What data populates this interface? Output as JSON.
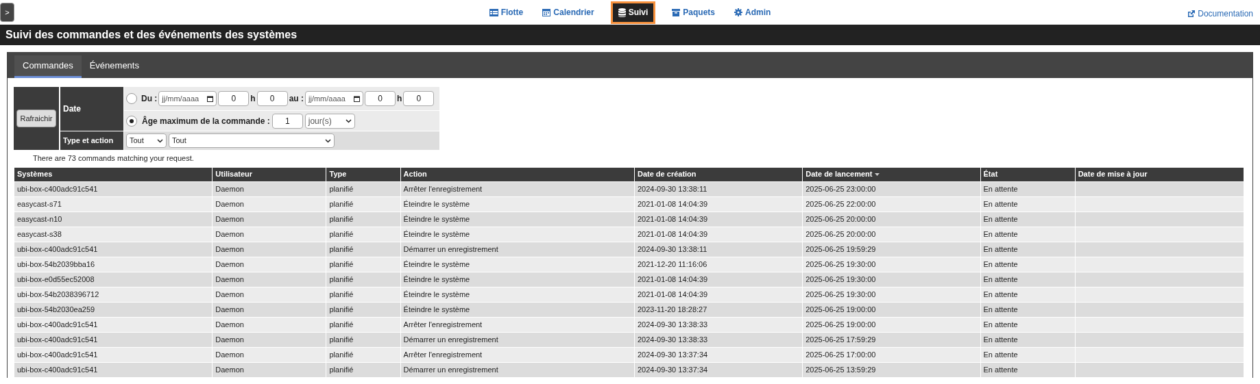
{
  "sidebar_toggle": ">",
  "nav": [
    {
      "label": "Flotte",
      "kind": "table",
      "selected": false
    },
    {
      "label": "Calendrier",
      "kind": "calendar",
      "selected": false
    },
    {
      "label": "Suivi",
      "kind": "database",
      "selected": true
    },
    {
      "label": "Paquets",
      "kind": "box",
      "selected": false
    },
    {
      "label": "Admin",
      "kind": "gear",
      "selected": false
    }
  ],
  "documentation_link": "Documentation",
  "page_title": "Suivi des commandes et des événements des systèmes",
  "tabs": [
    {
      "label": "Commandes",
      "selected": true
    },
    {
      "label": "Événements",
      "selected": false
    }
  ],
  "filters": {
    "refresh_button": "Rafraichir",
    "date_label": "Date",
    "modes": [
      {
        "kind": "range",
        "selected": false,
        "from_label": "Du :",
        "from_date": {
          "placeholder": "jj/mm/aaaa"
        },
        "from_hour": "0",
        "h1": "h",
        "from_minute": "0",
        "to_label": "au :",
        "to_date": {
          "placeholder": "jj/mm/aaaa"
        },
        "to_hour": "0",
        "h2": "h",
        "to_minute": "0"
      },
      {
        "kind": "age",
        "selected": true,
        "label": "Âge maximum de la commande :",
        "value": "1",
        "unit": "jour(s)"
      }
    ],
    "type_label": "Type et action",
    "type_select": "Tout",
    "action_select": "Tout"
  },
  "result_count": "There are 73 commands matching your request.",
  "table": {
    "columns": [
      {
        "label": "Systèmes",
        "sorted": false
      },
      {
        "label": "Utilisateur",
        "sorted": false
      },
      {
        "label": "Type",
        "sorted": false
      },
      {
        "label": "Action",
        "sorted": false
      },
      {
        "label": "Date de création",
        "sorted": false
      },
      {
        "label": "Date de lancement",
        "sorted": true
      },
      {
        "label": "État",
        "sorted": false
      },
      {
        "label": "Date de mise à jour",
        "sorted": false
      }
    ],
    "rows": [
      [
        "ubi-box-c400adc91c541",
        "Daemon",
        "planifié",
        "Arrêter l'enregistrement",
        "2024-09-30 13:38:11",
        "2025-06-25 23:00:00",
        "En attente"
      ],
      [
        "easycast-s71",
        "Daemon",
        "planifié",
        "Éteindre le système",
        "2021-01-08 14:04:39",
        "2025-06-25 22:00:00",
        "En attente"
      ],
      [
        "easycast-n10",
        "Daemon",
        "planifié",
        "Éteindre le système",
        "2021-01-08 14:04:39",
        "2025-06-25 20:00:00",
        "En attente"
      ],
      [
        "easycast-s38",
        "Daemon",
        "planifié",
        "Éteindre le système",
        "2021-01-08 14:04:39",
        "2025-06-25 20:00:00",
        "En attente"
      ],
      [
        "ubi-box-c400adc91c541",
        "Daemon",
        "planifié",
        "Démarrer un enregistrement",
        "2024-09-30 13:38:11",
        "2025-06-25 19:59:29",
        "En attente"
      ],
      [
        "ubi-box-54b2039bba16",
        "Daemon",
        "planifié",
        "Éteindre le système",
        "2021-12-20 11:16:06",
        "2025-06-25 19:30:00",
        "En attente"
      ],
      [
        "ubi-box-e0d55ec52008",
        "Daemon",
        "planifié",
        "Éteindre le système",
        "2021-01-08 14:04:39",
        "2025-06-25 19:30:00",
        "En attente"
      ],
      [
        "ubi-box-54b2038396712",
        "Daemon",
        "planifié",
        "Éteindre le système",
        "2021-01-08 14:04:39",
        "2025-06-25 19:30:00",
        "En attente"
      ],
      [
        "ubi-box-54b2030ea259",
        "Daemon",
        "planifié",
        "Éteindre le système",
        "2023-11-20 18:28:27",
        "2025-06-25 19:00:00",
        "En attente"
      ],
      [
        "ubi-box-c400adc91c541",
        "Daemon",
        "planifié",
        "Arrêter l'enregistrement",
        "2024-09-30 13:38:33",
        "2025-06-25 19:00:00",
        "En attente"
      ],
      [
        "ubi-box-c400adc91c541",
        "Daemon",
        "planifié",
        "Démarrer un enregistrement",
        "2024-09-30 13:38:33",
        "2025-06-25 17:59:29",
        "En attente"
      ],
      [
        "ubi-box-c400adc91c541",
        "Daemon",
        "planifié",
        "Arrêter l'enregistrement",
        "2024-09-30 13:37:34",
        "2025-06-25 17:00:00",
        "En attente"
      ],
      [
        "ubi-box-c400adc91c541",
        "Daemon",
        "planifié",
        "Démarrer un enregistrement",
        "2024-09-30 13:37:34",
        "2025-06-25 13:59:29",
        "En attente"
      ]
    ]
  }
}
